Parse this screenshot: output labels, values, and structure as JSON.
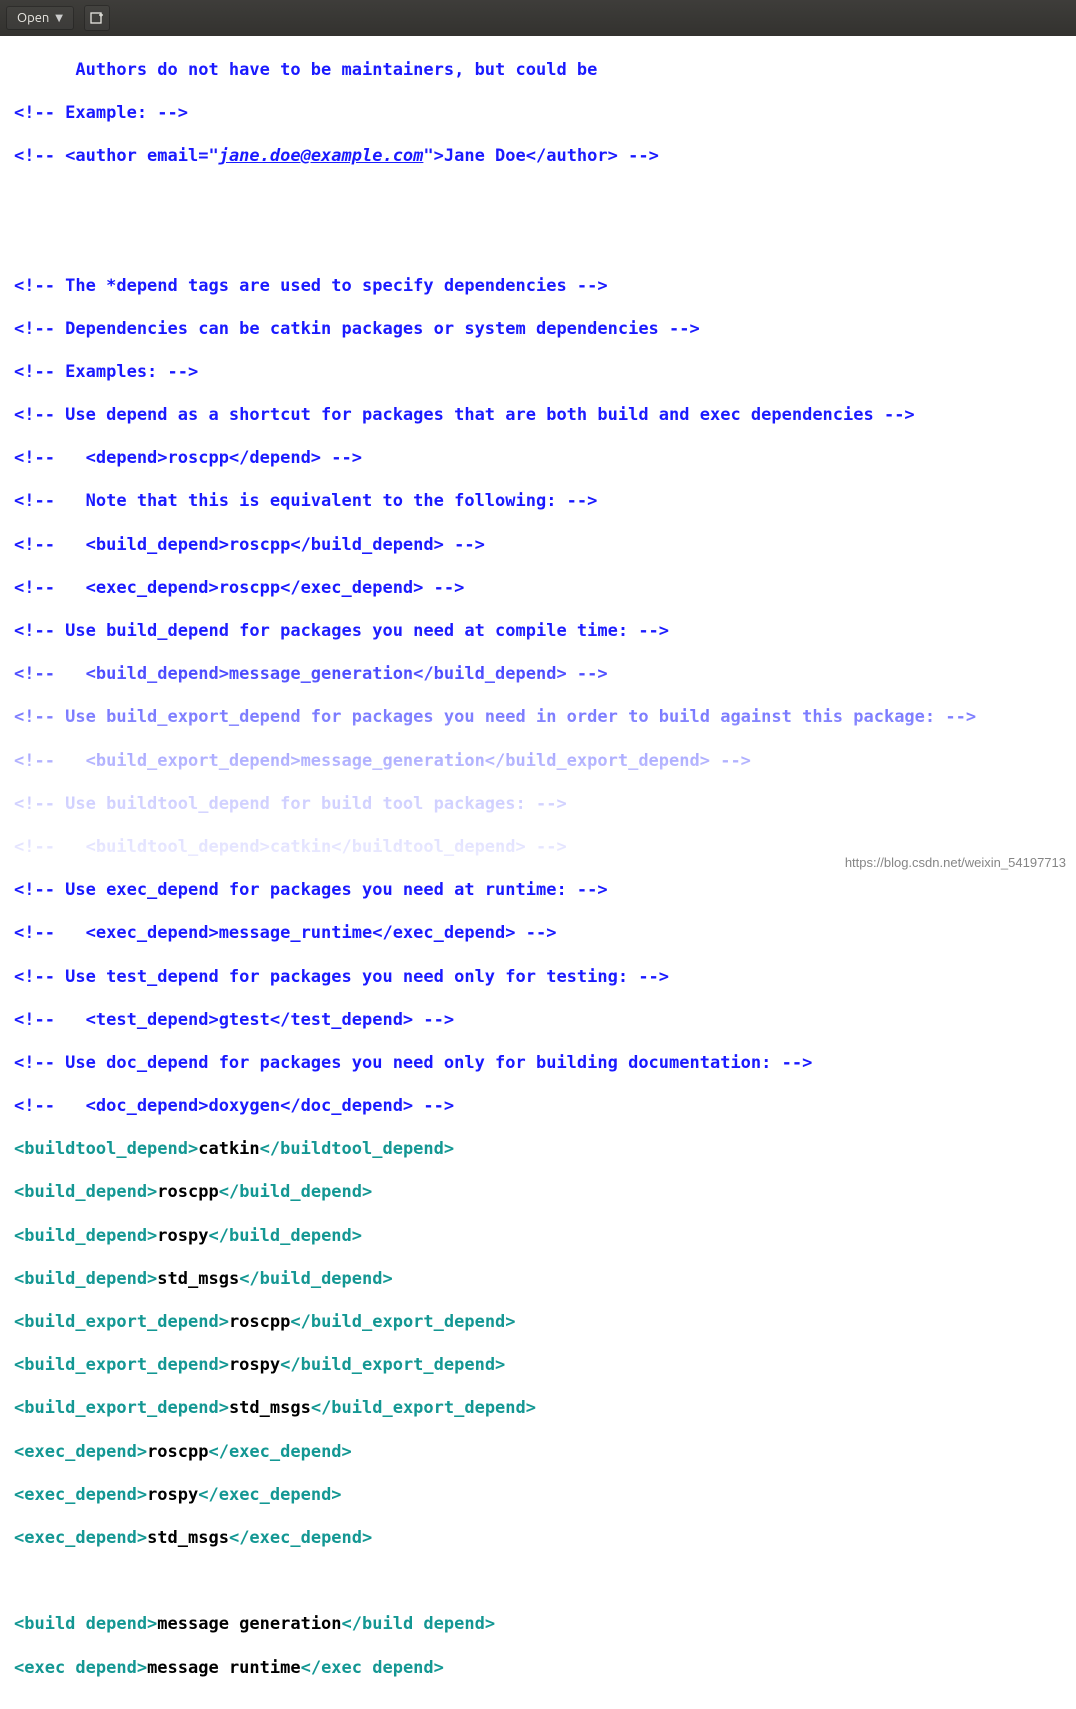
{
  "toolbar": {
    "open_label": "Open"
  },
  "watermark": "https://blog.csdn.net/weixin_54197713",
  "code": {
    "l0": "      Authors do not have to be maintainers, but could be",
    "l1": "<!-- Example: -->",
    "l2a": "<!-- <author email=\"",
    "l2b": "jane.doe@example.com",
    "l2c": "\">Jane Doe</author> -->",
    "l3": "<!-- The *depend tags are used to specify dependencies -->",
    "l4": "<!-- Dependencies can be catkin packages or system dependencies -->",
    "l5": "<!-- Examples: -->",
    "l6": "<!-- Use depend as a shortcut for packages that are both build and exec dependencies -->",
    "l7": "<!--   <depend>roscpp</depend> -->",
    "l8": "<!--   Note that this is equivalent to the following: -->",
    "l9": "<!--   <build_depend>roscpp</build_depend> -->",
    "l10": "<!--   <exec_depend>roscpp</exec_depend> -->",
    "l11": "<!-- Use build_depend for packages you need at compile time: -->",
    "l12": "<!--   <build_depend>message_generation</build_depend> -->",
    "l13": "<!-- Use build_export_depend for packages you need in order to build against this package: -->",
    "l14": "<!--   <build_export_depend>message_generation</build_export_depend> -->",
    "l15": "<!-- Use buildtool_depend for build tool packages: -->",
    "l16": "<!--   <buildtool_depend>catkin</buildtool_depend> -->",
    "l17": "<!-- Use exec_depend for packages you need at runtime: -->",
    "l18": "<!--   <exec_depend>message_runtime</exec_depend> -->",
    "l19": "<!-- Use test_depend for packages you need only for testing: -->",
    "l20": "<!--   <test_depend>gtest</test_depend> -->",
    "l21": "<!-- Use doc_depend for packages you need only for building documentation: -->",
    "l22": "<!--   <doc_depend>doxygen</doc_depend> -->",
    "t23o": "<buildtool_depend>",
    "t23t": "catkin",
    "t23c": "</buildtool_depend>",
    "t24o": "<build_depend>",
    "t24t": "roscpp",
    "t24c": "</build_depend>",
    "t25o": "<build_depend>",
    "t25t": "rospy",
    "t25c": "</build_depend>",
    "t26o": "<build_depend>",
    "t26t": "std_msgs",
    "t26c": "</build_depend>",
    "t27o": "<build_export_depend>",
    "t27t": "roscpp",
    "t27c": "</build_export_depend>",
    "t28o": "<build_export_depend>",
    "t28t": "rospy",
    "t28c": "</build_export_depend>",
    "t29o": "<build_export_depend>",
    "t29t": "std_msgs",
    "t29c": "</build_export_depend>",
    "t30o": "<exec_depend>",
    "t30t": "roscpp",
    "t30c": "</exec_depend>",
    "t31o": "<exec_depend>",
    "t31t": "rospy",
    "t31c": "</exec_depend>",
    "t32o": "<exec_depend>",
    "t32t": "std_msgs",
    "t32c": "</exec_depend>",
    "t33o": "<build depend>",
    "t33t": "message generation",
    "t33c": "</build depend>",
    "t34o": "<exec depend>",
    "t34t": "message runtime",
    "t34c": "</exec depend>"
  }
}
